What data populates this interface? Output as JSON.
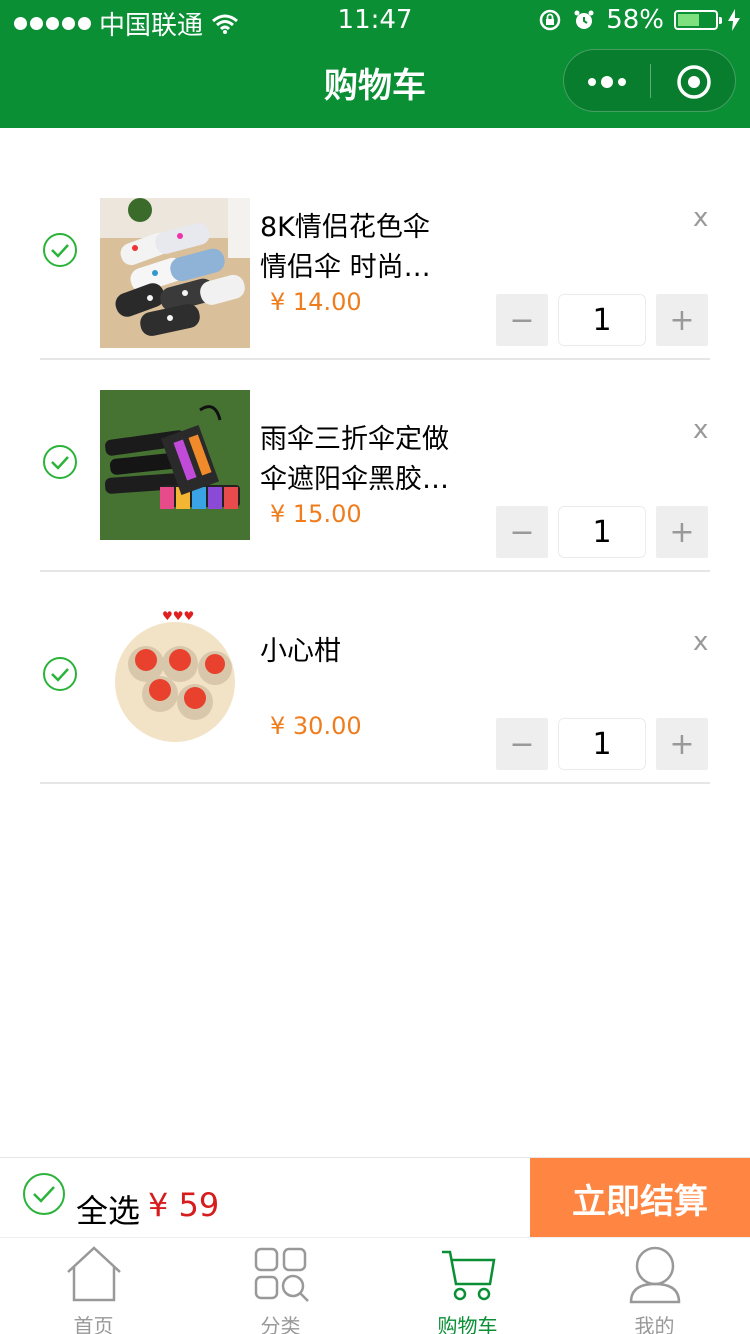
{
  "status_bar": {
    "carrier": "中国联通",
    "time": "11:47",
    "battery": "58%",
    "battery_level": 0.58
  },
  "nav": {
    "title": "购物车"
  },
  "cart": {
    "items": [
      {
        "title_line1": "8K情侣花色伞",
        "title_line2": "情侣伞 时尚…",
        "price": "¥ 14.00",
        "quantity": "1",
        "remove": "x",
        "checked": true
      },
      {
        "title_line1": "雨伞三折伞定做",
        "title_line2": "伞遮阳伞黑胶…",
        "price": "¥ 15.00",
        "quantity": "1",
        "remove": "x",
        "checked": true
      },
      {
        "title_line1": "小心柑",
        "title_line2": "",
        "price": "¥ 30.00",
        "quantity": "1",
        "remove": "x",
        "checked": true
      }
    ],
    "minus_label": "−",
    "plus_label": "+"
  },
  "summary": {
    "select_all": "全选",
    "total": "¥ 59",
    "checkout": "立即结算"
  },
  "tabbar": {
    "tabs": [
      {
        "label": "首页",
        "icon": "home-icon"
      },
      {
        "label": "分类",
        "icon": "category-icon"
      },
      {
        "label": "购物车",
        "icon": "cart-icon",
        "active": true
      },
      {
        "label": "我的",
        "icon": "user-icon"
      }
    ]
  },
  "colors": {
    "brand_green": "#0a8f35",
    "price_orange": "#ef7d1e",
    "total_red": "#d61c1c",
    "checkout_orange": "#ff8543",
    "check_green": "#2bb33a"
  }
}
